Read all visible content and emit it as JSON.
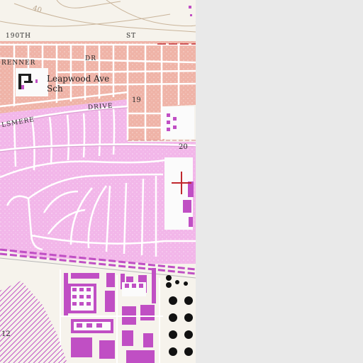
{
  "map": {
    "labels": {
      "street_190th": "190TH",
      "street_st": "ST",
      "renner": "RENNER",
      "dr": "DR",
      "school_line1": "Leapwood Ave",
      "school_line2": "Sch",
      "elsmere": "LSMERE",
      "drive": "DRIVE",
      "section_19": "19",
      "section_20": "20",
      "contour_40": "40",
      "edge_12": "12"
    },
    "colors": {
      "paper": "#f6f3ec",
      "urban_pink": "#f2b6e9",
      "urban_salmon": "#efb3a7",
      "building_purple": "#c04fc4",
      "road_white": "#ffffff",
      "marker_red": "#c0282d",
      "blank_panel": "#e9e9e9"
    },
    "marker": {
      "type": "crosshair",
      "color": "#c0282d"
    }
  }
}
